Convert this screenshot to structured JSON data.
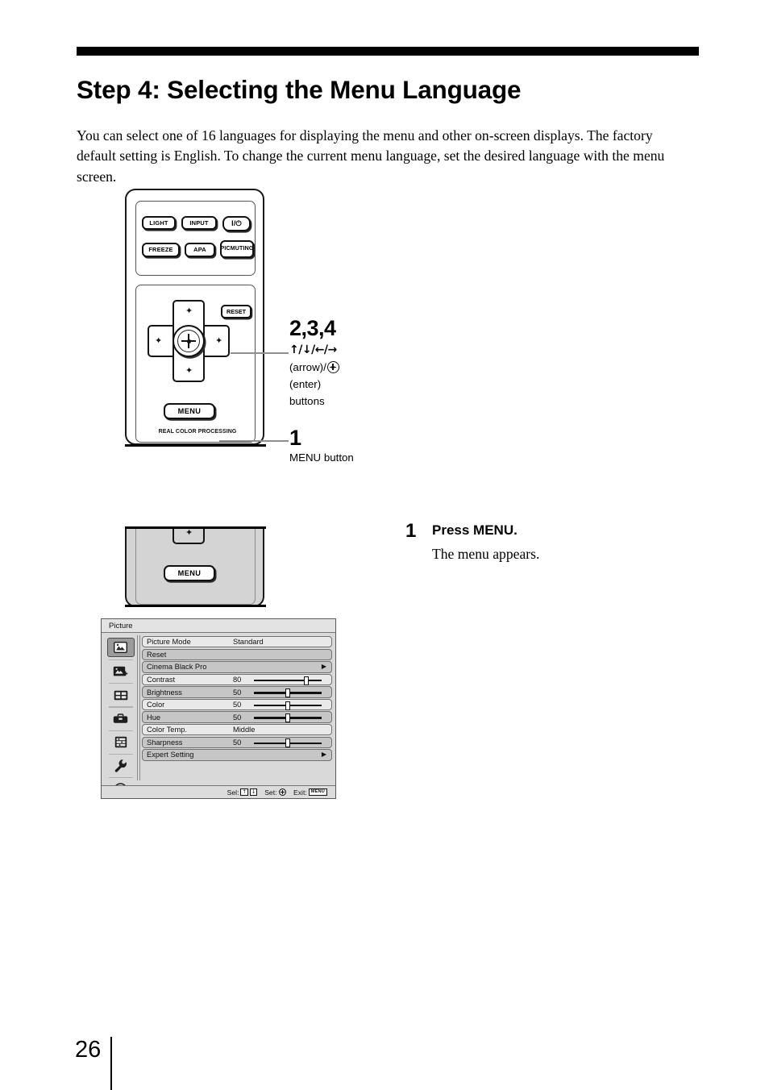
{
  "page": {
    "title": "Step 4: Selecting the Menu Language",
    "intro": "You can select one of 16 languages for displaying the menu and other on-screen displays. The factory default setting is English. To change the current menu language, set the desired language with the menu screen.",
    "page_number": "26"
  },
  "remote": {
    "buttons": {
      "light": "LIGHT",
      "input": "INPUT",
      "power": "I/⏻",
      "freeze": "FREEZE",
      "apa": "APA",
      "pic_muting": "PIC\nMUTING",
      "pic_muting_line1": "PIC",
      "pic_muting_line2": "MUTING",
      "reset": "RESET",
      "menu": "MENU"
    },
    "brand_text": "REAL COLOR PROCESSING",
    "arrow_up": "✦",
    "arrow_down": "✦",
    "arrow_left": "✦",
    "arrow_right": "✦"
  },
  "callouts": {
    "dpad": {
      "number": "2,3,4",
      "arrows": "↑/↓/←/→",
      "line2_prefix": "(arrow)/",
      "line3": "(enter)",
      "line4": "buttons"
    },
    "menu": {
      "number": "1",
      "label": "MENU  button"
    }
  },
  "step": {
    "number": "1",
    "heading": "Press MENU.",
    "body": "The menu appears."
  },
  "osd": {
    "title": "Picture",
    "sidebar_icons": [
      "picture-icon",
      "picture-plus-icon",
      "screen-grid-icon",
      "toolbox-icon",
      "setup-list-icon",
      "wrench-icon",
      "information-icon"
    ],
    "rows": [
      {
        "label": "Picture Mode",
        "value": "Standard",
        "shaded": false,
        "arrow": false,
        "slider": null
      },
      {
        "label": "Reset",
        "value": "",
        "shaded": true,
        "arrow": false,
        "slider": null
      },
      {
        "label": "Cinema Black Pro",
        "value": "",
        "shaded": true,
        "arrow": true,
        "slider": null
      },
      {
        "label": "Contrast",
        "value": "80",
        "shaded": false,
        "arrow": false,
        "slider": 80
      },
      {
        "label": "Brightness",
        "value": "50",
        "shaded": true,
        "arrow": false,
        "slider": 50
      },
      {
        "label": "Color",
        "value": "50",
        "shaded": false,
        "arrow": false,
        "slider": 50
      },
      {
        "label": "Hue",
        "value": "50",
        "shaded": true,
        "arrow": false,
        "slider": 50
      },
      {
        "label": "Color Temp.",
        "value": "Middle",
        "shaded": false,
        "arrow": false,
        "slider": null
      },
      {
        "label": "Sharpness",
        "value": "50",
        "shaded": true,
        "arrow": false,
        "slider": 50
      },
      {
        "label": "Expert Setting",
        "value": "",
        "shaded": true,
        "arrow": true,
        "slider": null
      }
    ],
    "status": {
      "sel_label": "Sel:",
      "sel_key_up": "↑",
      "sel_key_down": "↓",
      "set_label": "Set:",
      "exit_label": "Exit:",
      "exit_key": "MENU"
    }
  }
}
